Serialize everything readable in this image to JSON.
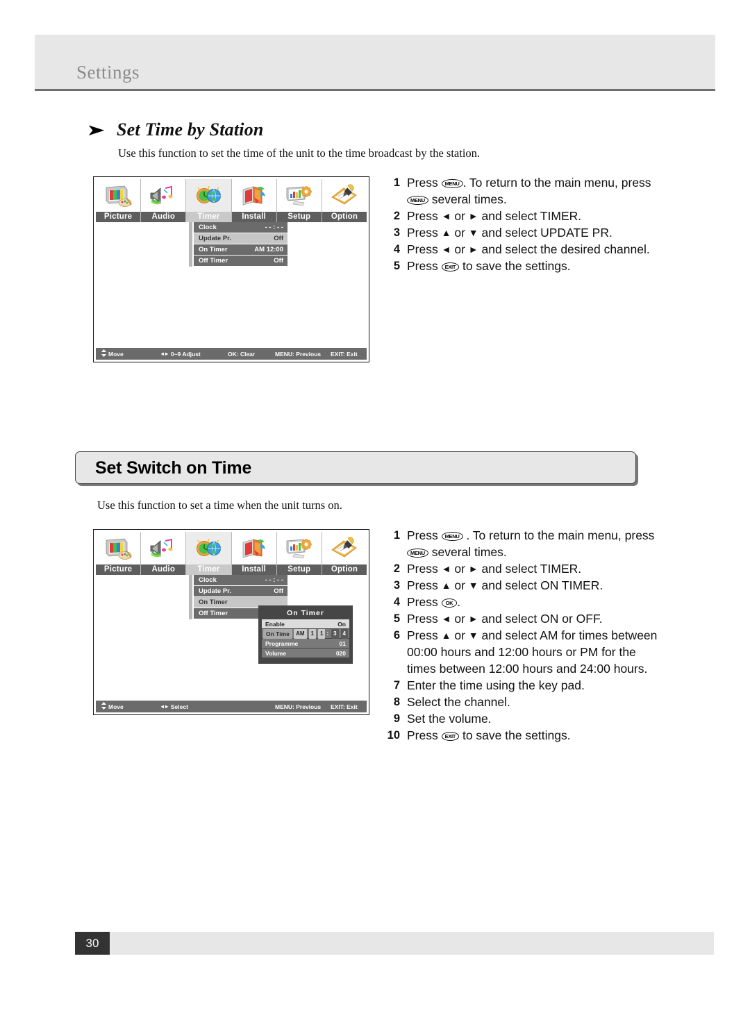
{
  "header": {
    "title": "Settings"
  },
  "subsection": {
    "arrow": "arrow-bullet-icon",
    "title": "Set Time by Station",
    "description": "Use this function to set the time of the unit to the time broadcast by the station."
  },
  "section": {
    "title": "Set Switch on Time",
    "description": "Use this function to set a time when the unit turns on."
  },
  "osd_menu": {
    "tabs": [
      {
        "label": "Picture",
        "icon": "picture-tv-palette-icon",
        "active": false
      },
      {
        "label": "Audio",
        "icon": "audio-speaker-note-icon",
        "active": false
      },
      {
        "label": "Timer",
        "icon": "timer-clock-globe-icon",
        "active": true
      },
      {
        "label": "Install",
        "icon": "install-books-icon",
        "active": false
      },
      {
        "label": "Setup",
        "icon": "setup-monitor-gear-icon",
        "active": false
      },
      {
        "label": "Option",
        "icon": "option-notepad-pen-icon",
        "active": false
      }
    ]
  },
  "osd_one": {
    "submenu": [
      {
        "label": "Clock",
        "value": "- - : - -",
        "selected": false
      },
      {
        "label": "Update Pr.",
        "value": "Off",
        "selected": true
      },
      {
        "label": "On Timer",
        "value": "AM 12:00",
        "selected": false
      },
      {
        "label": "Off Timer",
        "value": "Off",
        "selected": false
      }
    ],
    "status": {
      "move": "Move",
      "adjust": "0~9  Adjust",
      "ok": "OK: Clear",
      "menu": "MENU: Previous",
      "exit": "EXIT: Exit"
    }
  },
  "osd_two": {
    "submenu": [
      {
        "label": "Clock",
        "value": "- - : - -",
        "selected": false
      },
      {
        "label": "Update Pr.",
        "value": "Off",
        "selected": false
      },
      {
        "label": "On Timer",
        "value": "",
        "selected": true
      },
      {
        "label": "Off Timer",
        "value": "",
        "selected": false
      }
    ],
    "dialog": {
      "title": "On Timer",
      "rows": {
        "enable_label": "Enable",
        "enable_value": "On",
        "ontime_label": "On Time",
        "ontime_ampm": "AM",
        "ontime_h1": "1",
        "ontime_h2": "1",
        "ontime_m1": "3",
        "ontime_m2": "4",
        "programme_label": "Programme",
        "programme_value": "01",
        "volume_label": "Volume",
        "volume_value": "020"
      }
    },
    "status": {
      "move": "Move",
      "select": "Select",
      "menu": "MENU: Previous",
      "exit": "EXIT: Exit"
    }
  },
  "steps_one": [
    {
      "num": "1",
      "html": "Press <span class=\"keycap\">MENU</span>. To return to the main menu, press"
    },
    {
      "num": "",
      "html": "<span class=\"keycap\">MENU</span> several times."
    },
    {
      "num": "2",
      "html": "Press <span class=\"dir\">&#9668;</span> or <span class=\"dir\">&#9658;</span> and select TIMER."
    },
    {
      "num": "3",
      "html": "Press <span class=\"dir\">&#9650;</span> or <span class=\"dir\">&#9660;</span> and select UPDATE PR."
    },
    {
      "num": "4",
      "html": "Press <span class=\"dir\">&#9668;</span> or <span class=\"dir\">&#9658;</span> and select the desired channel."
    },
    {
      "num": "5",
      "html": "Press <span class=\"keycap\">EXIT</span> to save the settings."
    }
  ],
  "steps_two": [
    {
      "num": "1",
      "html": "Press <span class=\"keycap\">MENU</span> . To return to the main menu, press"
    },
    {
      "num": "",
      "html": "<span class=\"keycap\">MENU</span> several times."
    },
    {
      "num": "2",
      "html": "Press <span class=\"dir\">&#9668;</span> or <span class=\"dir\">&#9658;</span> and select TIMER."
    },
    {
      "num": "3",
      "html": "Press <span class=\"dir\">&#9650;</span> or <span class=\"dir\">&#9660;</span> and select ON TIMER."
    },
    {
      "num": "4",
      "html": "Press <span class=\"keycap ok\">OK</span>."
    },
    {
      "num": "5",
      "html": "Press <span class=\"dir\">&#9668;</span> or <span class=\"dir\">&#9658;</span> and select ON or OFF."
    },
    {
      "num": "6",
      "html": "Press <span class=\"dir\">&#9650;</span> or <span class=\"dir\">&#9660;</span> and select AM for times between"
    },
    {
      "num": "",
      "html": "00:00 hours and 12:00 hours or PM for the"
    },
    {
      "num": "",
      "html": "times between 12:00 hours and 24:00 hours."
    },
    {
      "num": "7",
      "html": "Enter the time using the key pad."
    },
    {
      "num": "8",
      "html": "Select the channel."
    },
    {
      "num": "9",
      "html": "Set the volume."
    },
    {
      "num": "10",
      "html": "Press <span class=\"keycap\">EXIT</span> to save the settings."
    }
  ],
  "footer": {
    "page_number": "30"
  },
  "colors": {
    "band": "#e7e7e7",
    "band_rule": "#6e6e6e",
    "page_badge": "#333333",
    "osd_row": "#6b6b6b",
    "osd_row_selected": "#c6c6c6",
    "dialog_bg": "#464646"
  }
}
